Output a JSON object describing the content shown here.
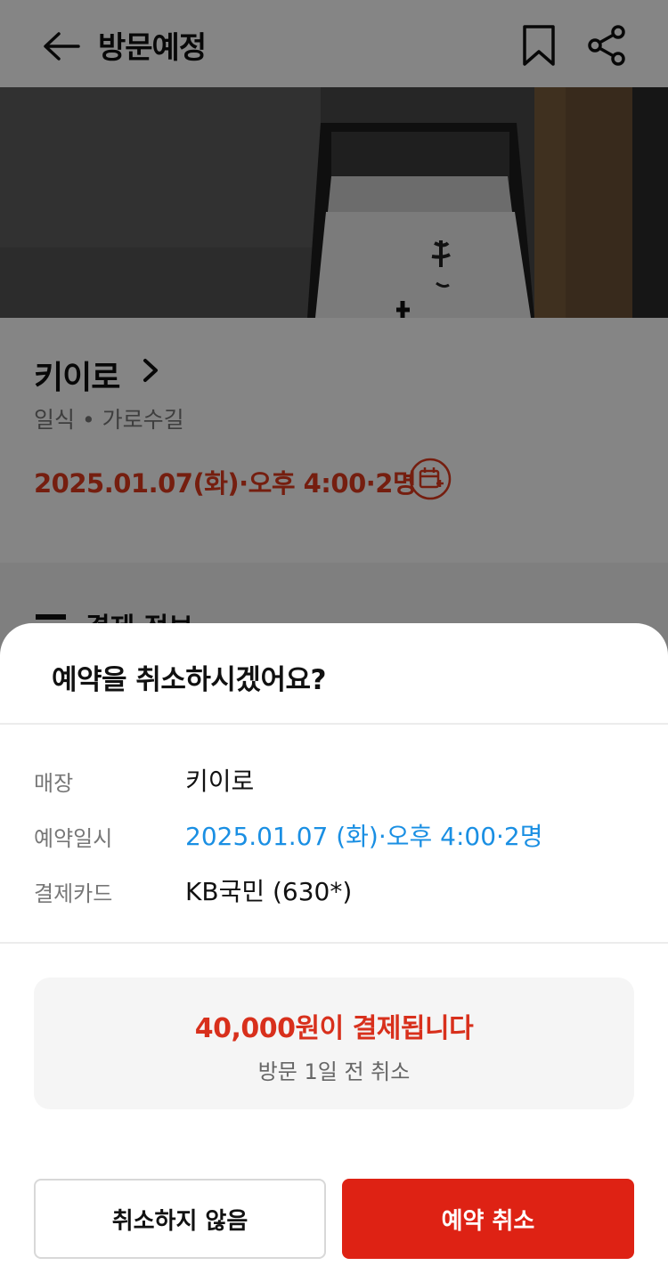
{
  "header": {
    "title": "방문예정",
    "back_icon": "arrow-left-icon",
    "bookmark_icon": "bookmark-icon",
    "share_icon": "share-icon"
  },
  "store": {
    "name": "키이로",
    "meta": "일식 • 가로수길",
    "datetime": "2025.01.07(화)·오후 4:00·2명",
    "calendar_icon": "calendar-add-icon"
  },
  "payment_section": {
    "title": "결제 정보"
  },
  "sheet": {
    "title": "예약을 취소하시겠어요?",
    "rows": [
      {
        "label": "매장",
        "value": "키이로"
      },
      {
        "label": "예약일시",
        "value": "2025.01.07 (화)·오후 4:00·2명"
      },
      {
        "label": "결제카드",
        "value": "KB국민 (630*)"
      }
    ],
    "amount_text": "40,000원이 결제됩니다",
    "note_text": "방문 1일 전 취소",
    "keep_button": "취소하지 않음",
    "cancel_button": "예약 취소"
  },
  "colors": {
    "accent_red": "#de2214",
    "datetime_red": "#e03a1e",
    "link_blue": "#1a8fe3"
  }
}
